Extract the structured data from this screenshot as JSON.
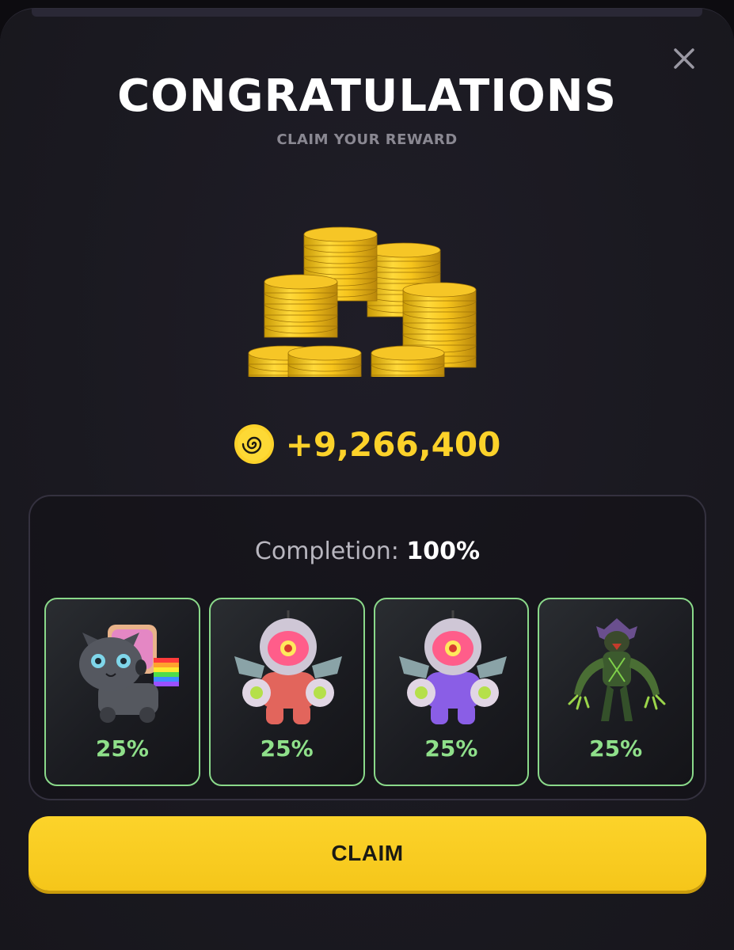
{
  "modal": {
    "title": "CONGRATULATIONS",
    "subtitle": "CLAIM YOUR REWARD",
    "close_icon": "close-icon",
    "reward_icon": "coin-swirl-icon",
    "reward_amount": "+9,266,400"
  },
  "completion": {
    "label": "Completion: ",
    "value": "100%"
  },
  "cards": [
    {
      "name": "cyber-cat-card",
      "icon": "robot-cat-icon",
      "percent": "25%",
      "share": 0.25
    },
    {
      "name": "astro-robot-red-card",
      "icon": "astronaut-robot-icon",
      "percent": "25%",
      "share": 0.25
    },
    {
      "name": "astro-robot-purple-card",
      "icon": "astronaut-robot-icon",
      "percent": "25%",
      "share": 0.25
    },
    {
      "name": "alien-creature-card",
      "icon": "alien-creature-icon",
      "percent": "25%",
      "share": 0.25
    }
  ],
  "actions": {
    "claim_label": "CLAIM"
  },
  "colors": {
    "accent": "#fcd22a",
    "card_border": "#8ad98a",
    "percent_text": "#8fe08a",
    "background": "#1a1920"
  }
}
